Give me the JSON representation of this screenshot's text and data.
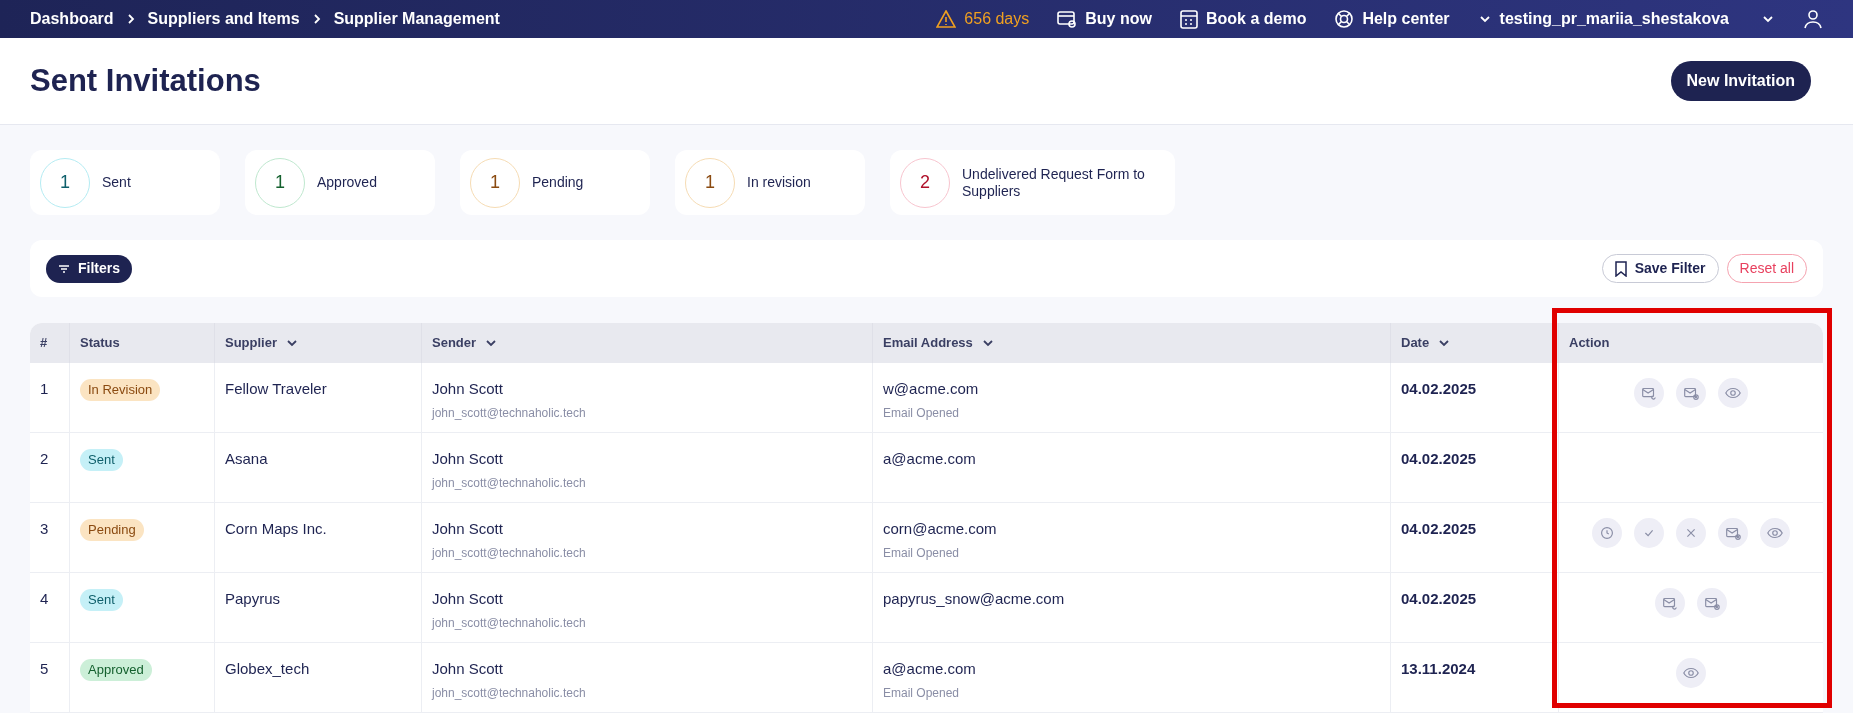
{
  "breadcrumbs": [
    "Dashboard",
    "Suppliers and Items",
    "Supplier Management"
  ],
  "topbar": {
    "trial": "656 days",
    "buy": "Buy now",
    "demo": "Book a demo",
    "help": "Help center",
    "user": "testing_pr_mariia_shestakova"
  },
  "page_title": "Sent Invitations",
  "new_button": "New Invitation",
  "summary": [
    {
      "count": "1",
      "label": "Sent",
      "kind": "sent"
    },
    {
      "count": "1",
      "label": "Approved",
      "kind": "approved"
    },
    {
      "count": "1",
      "label": "Pending",
      "kind": "pending"
    },
    {
      "count": "1",
      "label": "In revision",
      "kind": "revision"
    },
    {
      "count": "2",
      "label": "Undelivered Request Form to Suppliers",
      "kind": "undelivered"
    }
  ],
  "filters": {
    "label": "Filters",
    "save": "Save Filter",
    "reset": "Reset all"
  },
  "table": {
    "columns": [
      {
        "label": "#",
        "sortable": false
      },
      {
        "label": "Status",
        "sortable": false
      },
      {
        "label": "Supplier",
        "sortable": true
      },
      {
        "label": "Sender",
        "sortable": true
      },
      {
        "label": "Email Address",
        "sortable": true
      },
      {
        "label": "Date",
        "sortable": true
      },
      {
        "label": "Action",
        "sortable": false
      }
    ],
    "rows": [
      {
        "index": "1",
        "status": "In Revision",
        "kind": "revision",
        "supplier": "Fellow Traveler",
        "sender": "John Scott",
        "sender_email": "john_scott@technaholic.tech",
        "email": "w@acme.com",
        "email_note": "Email Opened",
        "date": "04.02.2025",
        "actions": [
          {
            "kind": "resend"
          },
          {
            "kind": "cancel-mail"
          },
          {
            "kind": "view"
          }
        ]
      },
      {
        "index": "2",
        "status": "Sent",
        "kind": "sent",
        "supplier": "Asana",
        "sender": "John Scott",
        "sender_email": "john_scott@technaholic.tech",
        "email": "a@acme.com",
        "date": "04.02.2025",
        "actions": []
      },
      {
        "index": "3",
        "status": "Pending",
        "kind": "pending",
        "supplier": "Corn Maps Inc.",
        "sender": "John Scott",
        "sender_email": "john_scott@technaholic.tech",
        "email": "corn@acme.com",
        "email_note": "Email Opened",
        "date": "04.02.2025",
        "actions": [
          {
            "kind": "clock"
          },
          {
            "kind": "check"
          },
          {
            "kind": "close"
          },
          {
            "kind": "cancel-mail"
          },
          {
            "kind": "view"
          }
        ]
      },
      {
        "index": "4",
        "status": "Sent",
        "kind": "sent",
        "supplier": "Papyrus",
        "sender": "John Scott",
        "sender_email": "john_scott@technaholic.tech",
        "email": "papyrus_snow@acme.com",
        "date": "04.02.2025",
        "actions": [
          {
            "kind": "resend"
          },
          {
            "kind": "cancel-mail"
          }
        ]
      },
      {
        "index": "5",
        "status": "Approved",
        "kind": "approved",
        "supplier": "Globex_tech",
        "sender": "John Scott",
        "sender_email": "john_scott@technaholic.tech",
        "email": "a@acme.com",
        "email_note": "Email Opened",
        "date": "13.11.2024",
        "actions": [
          {
            "kind": "view"
          }
        ]
      }
    ]
  },
  "highlight_action_column": true
}
